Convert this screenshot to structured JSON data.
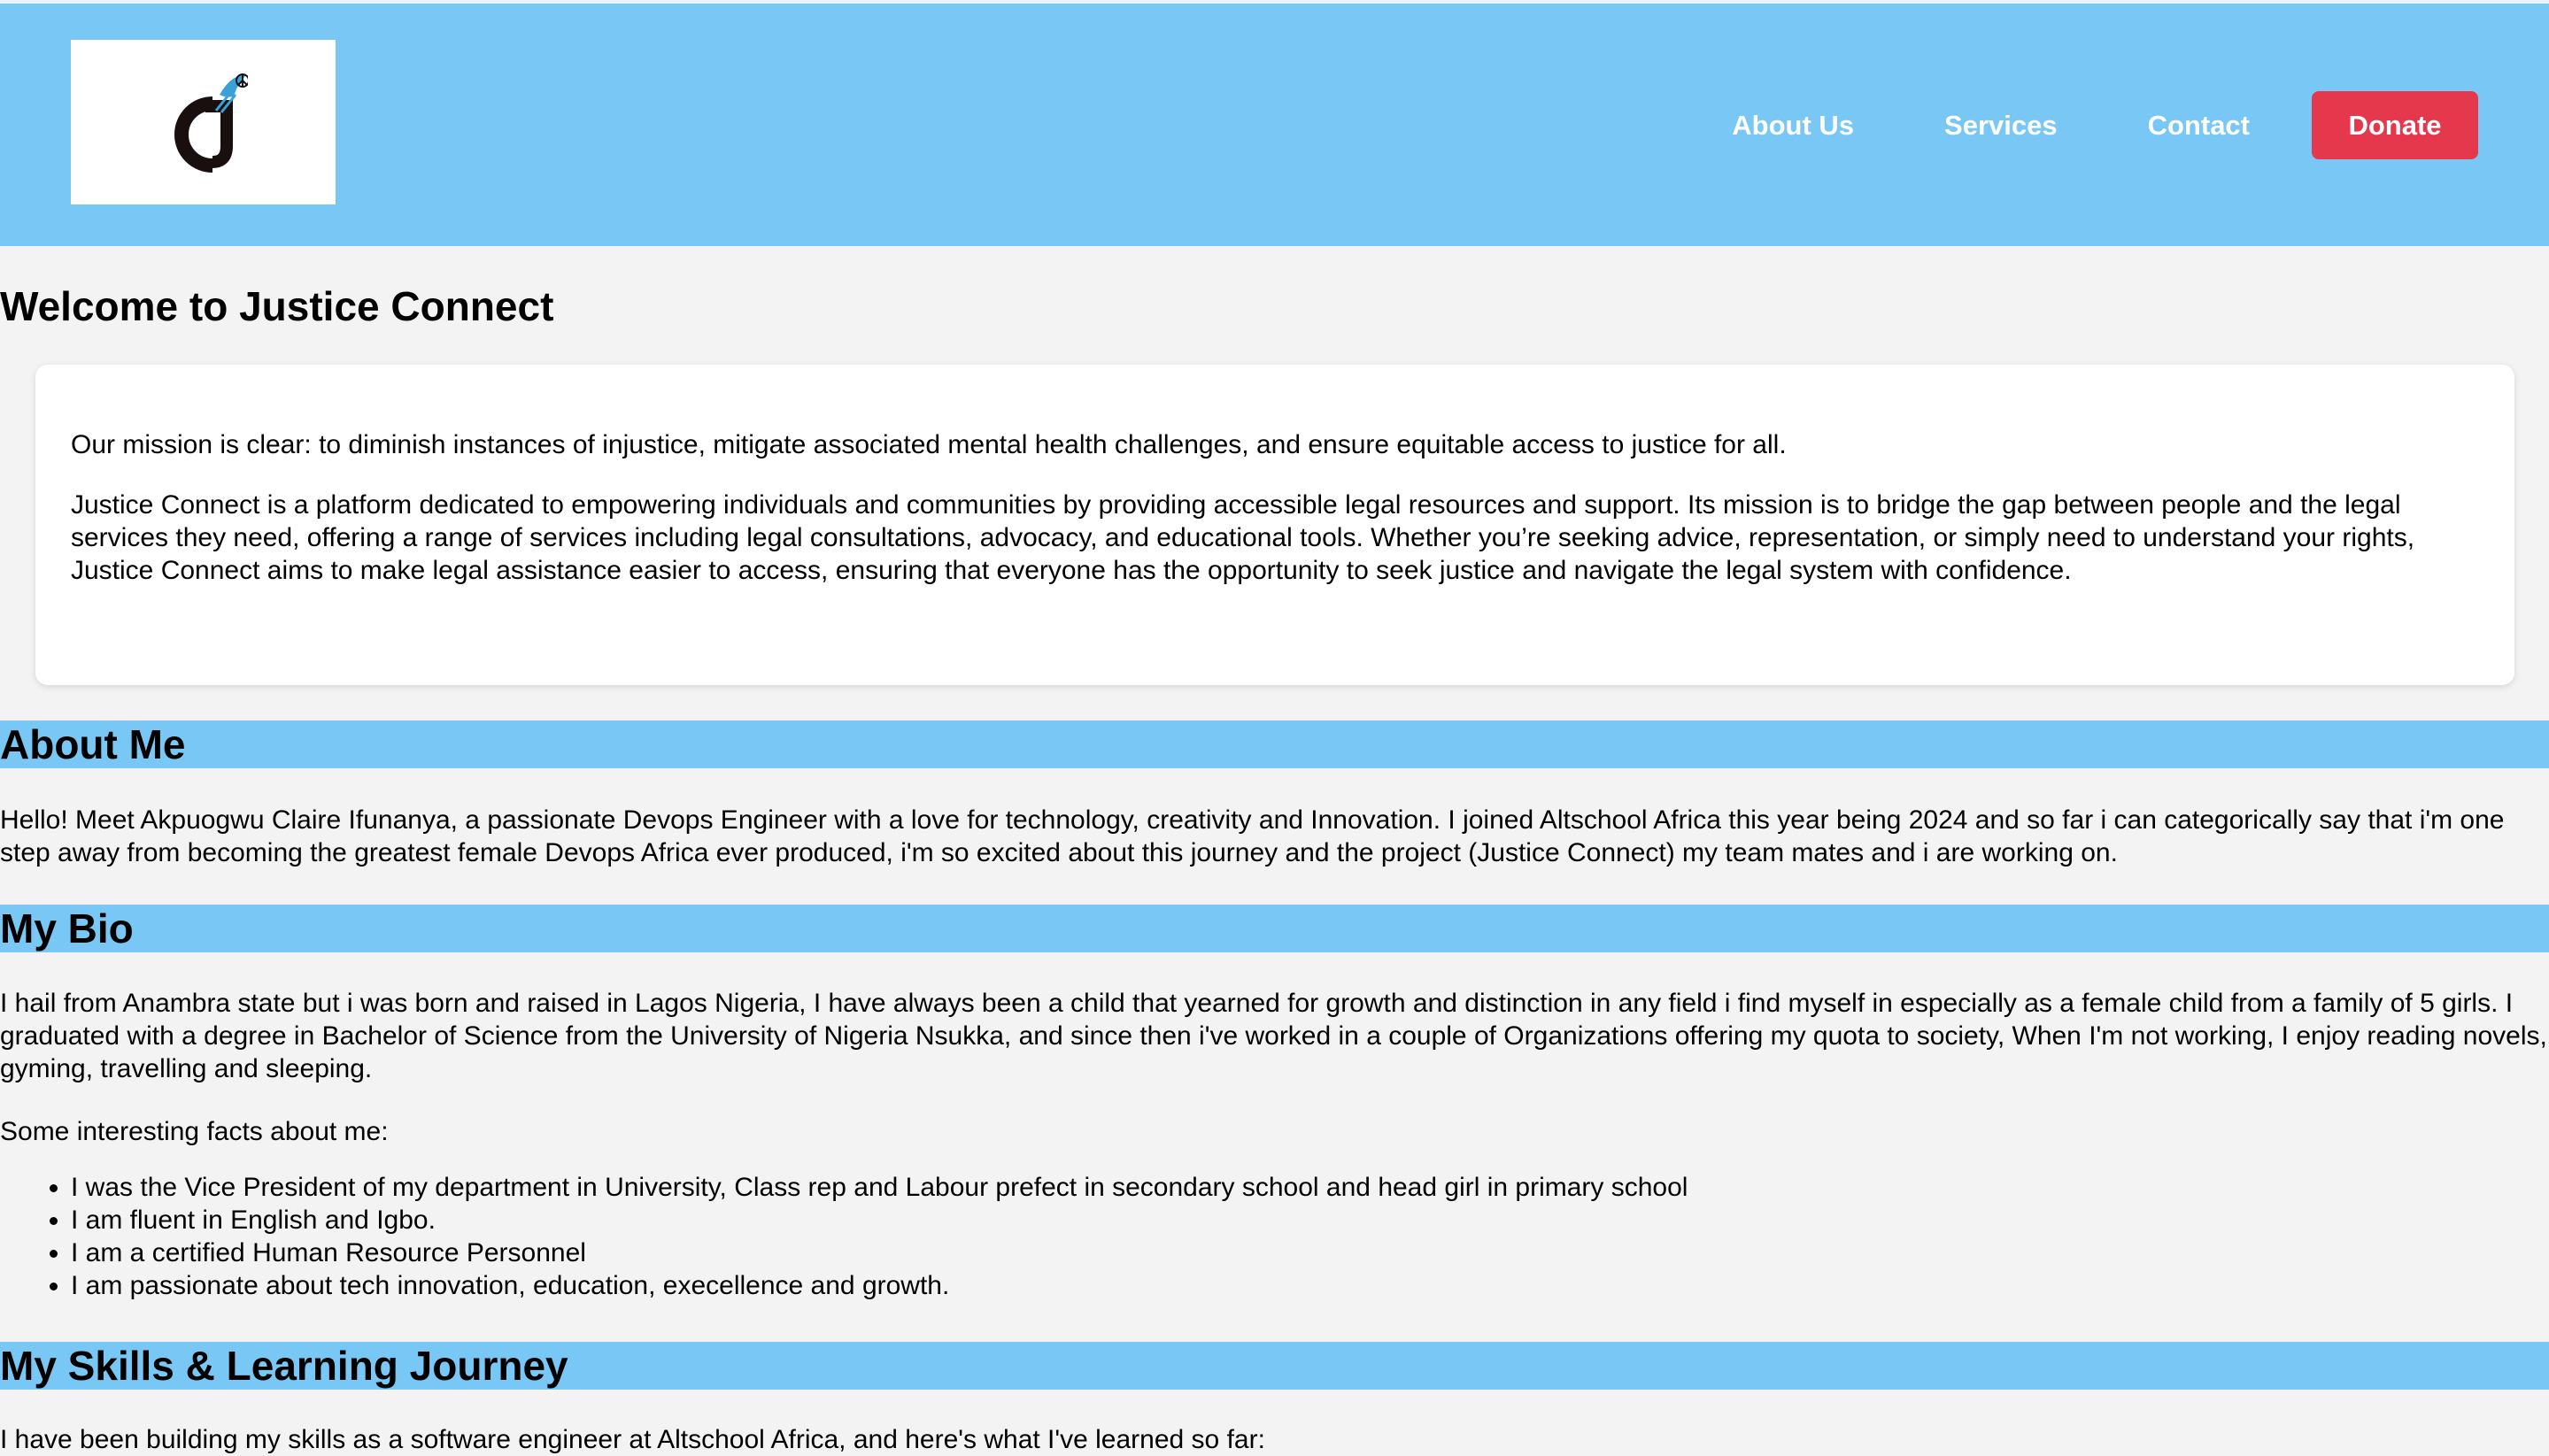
{
  "header": {
    "logo_alt": "Justice Connect logo",
    "nav": {
      "about": "About Us",
      "services": "Services",
      "contact": "Contact"
    },
    "donate_label": "Donate"
  },
  "main": {
    "title": "Welcome to Justice Connect",
    "mission_statement": "Our mission is clear: to diminish instances of injustice, mitigate associated mental health challenges, and ensure equitable access to justice for all.",
    "mission_description": "Justice Connect is a platform dedicated to empowering individuals and communities by providing accessible legal resources and support. Its mission is to bridge the gap between people and the legal services they need, offering a range of services including legal consultations, advocacy, and educational tools. Whether you’re seeking advice, representation, or simply need to understand your rights, Justice Connect aims to make legal assistance easier to access, ensuring that everyone has the opportunity to seek justice and navigate the legal system with confidence."
  },
  "about": {
    "heading": "About Me",
    "text": "Hello! Meet Akpuogwu Claire Ifunanya, a passionate Devops Engineer with a love for technology, creativity and Innovation. I joined Altschool Africa this year being 2024 and so far i can categorically say that i'm one step away from becoming the greatest female Devops Africa ever produced, i'm so excited about this journey and the project (Justice Connect) my team mates and i are working on."
  },
  "bio": {
    "heading": "My Bio",
    "text": "I hail from Anambra state but i was born and raised in Lagos Nigeria, I have always been a child that yearned for growth and distinction in any field i find myself in especially as a female child from a family of 5 girls. I graduated with a degree in Bachelor of Science from the University of Nigeria Nsukka, and since then i've worked in a couple of Organizations offering my quota to society, When I'm not working, I enjoy reading novels, gyming, travelling and sleeping.",
    "facts_intro": "Some interesting facts about me:",
    "facts": [
      "I was the Vice President of my department in University, Class rep and Labour prefect in secondary school and head girl in primary school",
      "I am fluent in English and Igbo.",
      "I am a certified Human Resource Personnel",
      "I am passionate about tech innovation, education, execellence and growth."
    ]
  },
  "skills": {
    "heading": "My Skills & Learning Journey",
    "intro": "I have been building my skills as a software engineer at Altschool Africa, and here's what I've learned so far:"
  },
  "colors": {
    "header_bg": "#78c7f5",
    "donate_bg": "#e5384d",
    "page_bg": "#f3f3f3"
  }
}
